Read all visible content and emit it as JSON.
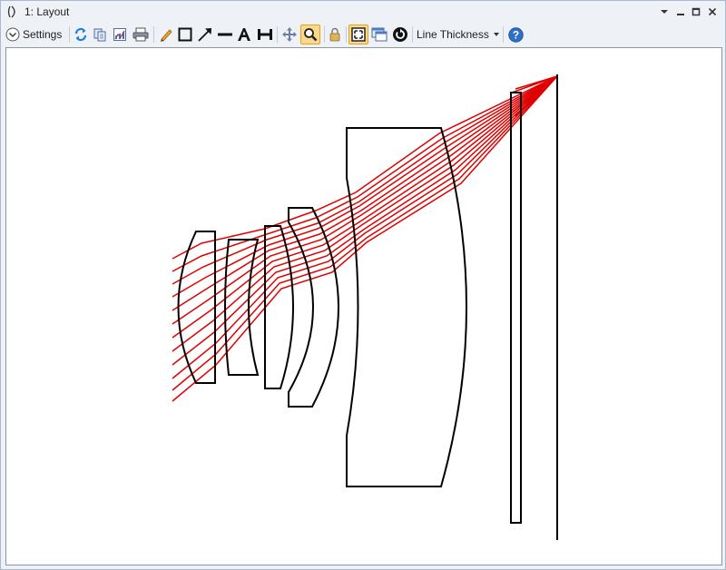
{
  "window": {
    "title": "1: Layout"
  },
  "toolbar": {
    "settings_label": "Settings",
    "line_thickness_label": "Line Thickness",
    "icons": [
      "settings-chevron-icon",
      "refresh-icon",
      "copy-icon",
      "export-icon",
      "print-icon",
      "pencil-icon",
      "rectangle-icon",
      "arrow-icon",
      "line-icon",
      "text-icon",
      "dimension-icon",
      "pan-icon",
      "zoom-icon",
      "lock-icon",
      "fit-icon",
      "window-icon",
      "reset-icon",
      "dropdown-icon",
      "help-icon"
    ]
  },
  "colors": {
    "ray": "#e00000",
    "lens": "#000000",
    "accent_pressed": "#fcd88a",
    "help_blue": "#2d6fc6"
  }
}
